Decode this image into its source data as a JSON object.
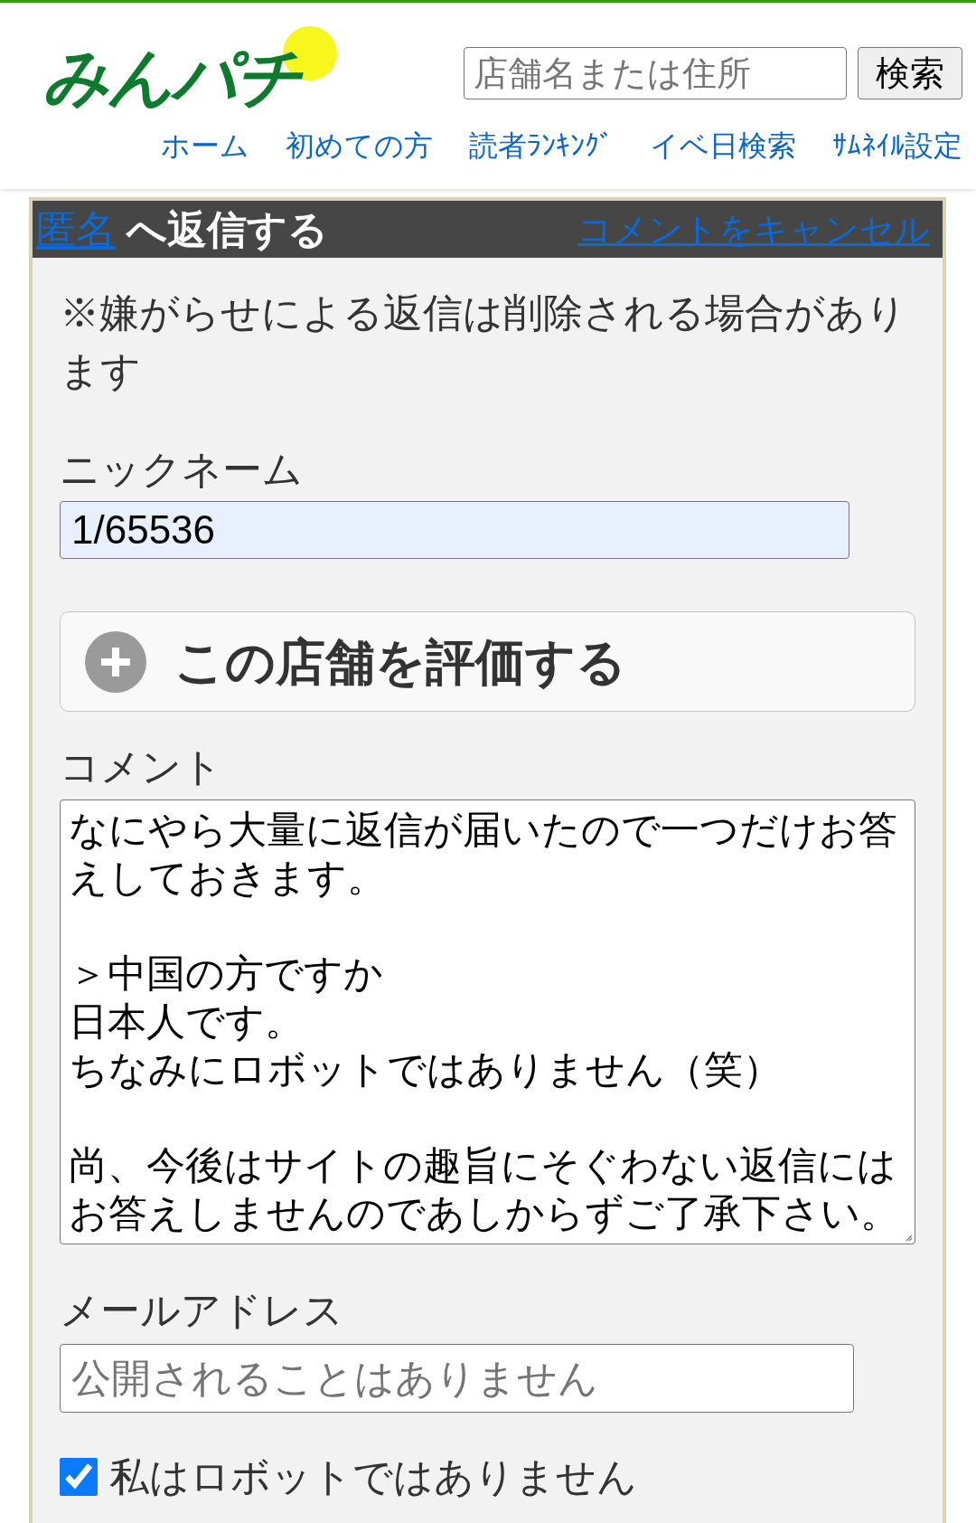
{
  "header": {
    "logo": "みんパチ",
    "search": {
      "placeholder": "店舗名または住所",
      "button": "検索"
    },
    "nav": [
      "ホーム",
      "初めての方",
      "読者ﾗﾝｷﾝｸﾞ",
      "イベ日検索",
      "ｻﾑﾈｲﾙ設定"
    ]
  },
  "reply_bar": {
    "author_link": "匿名",
    "title": "へ返信する",
    "cancel_link": "コメントをキャンセル"
  },
  "form": {
    "notice": "※嫌がらせによる返信は削除される場合があります",
    "nickname": {
      "label": "ニックネーム",
      "value": "1/65536",
      "autofilled": true
    },
    "rate_button": {
      "label": "この店舗を評価する",
      "expanded": false
    },
    "comment": {
      "label": "コメント",
      "paragraphs": [
        [
          "なにやら大量に返信が届いたので一つだけお答えしておきます。"
        ],
        [
          "＞中国の方ですか",
          "日本人です。",
          "ちなみにロボットではありません（笑）"
        ],
        [
          "尚、今後はサイトの趣旨にそぐわない返信にはお答えしませんのであしからずご了承下さい。"
        ]
      ]
    },
    "email": {
      "label": "メールアドレス",
      "placeholder": "公開されることはありません"
    },
    "robot_check": {
      "label": "私はロボットではありません",
      "checked": true
    }
  }
}
